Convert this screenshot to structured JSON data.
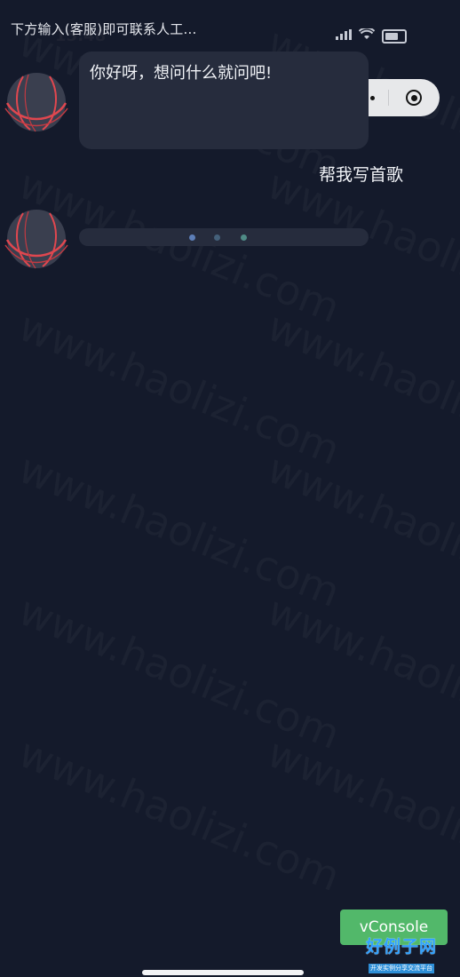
{
  "status_bar": {
    "time": "15:48",
    "notice": "下方输入(客服)即可联系人工...",
    "signal_icon": "signal-icon",
    "wifi_icon": "wifi-icon",
    "battery_icon": "battery-icon"
  },
  "capsule": {
    "more_icon": "more-dots-icon",
    "close_icon": "target-close-icon"
  },
  "chat": {
    "messages": [
      {
        "role": "assistant",
        "text": "你好呀，想问什么就问吧!"
      },
      {
        "role": "user",
        "text": "帮我写首歌"
      },
      {
        "role": "assistant",
        "text": "",
        "loading": true
      }
    ]
  },
  "watermark": {
    "text": "www.haolizi.com"
  },
  "vconsole": {
    "label": "vConsole"
  },
  "site_logo": {
    "title": "好例子网",
    "subtitle": "开发实例分享交流平台"
  },
  "colors": {
    "background": "#141a2b",
    "bubble": "#262c3d",
    "vconsole": "#52b86a",
    "avatar_accent": "#e0474f"
  }
}
